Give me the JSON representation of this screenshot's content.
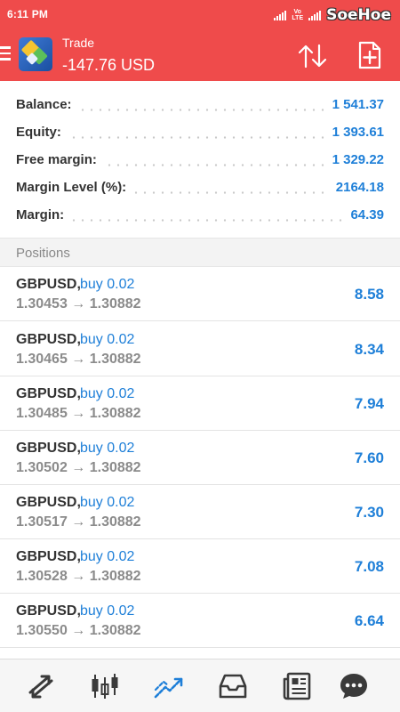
{
  "status_bar": {
    "time": "6:11 PM",
    "network_label": "LTE",
    "watermark": "SoeHoe"
  },
  "header": {
    "title": "Trade",
    "profit": "-147.76 USD",
    "icons": [
      "menu-icon",
      "metatrader-logo",
      "sort-icon",
      "new-order-icon"
    ]
  },
  "summary": {
    "rows": [
      {
        "label": "Balance:",
        "value": "1 541.37"
      },
      {
        "label": "Equity:",
        "value": "1 393.61"
      },
      {
        "label": "Free margin:",
        "value": "1 329.22"
      },
      {
        "label": "Margin Level (%):",
        "value": "2164.18"
      },
      {
        "label": "Margin:",
        "value": "64.39"
      }
    ]
  },
  "positions": {
    "title": "Positions",
    "rows": [
      {
        "symbol": "GBPUSD,",
        "type": "buy 0.02",
        "prices": "1.30453 → 1.30882",
        "profit": "8.58"
      },
      {
        "symbol": "GBPUSD,",
        "type": "buy 0.02",
        "prices": "1.30465 → 1.30882",
        "profit": "8.34"
      },
      {
        "symbol": "GBPUSD,",
        "type": "buy 0.02",
        "prices": "1.30485 → 1.30882",
        "profit": "7.94"
      },
      {
        "symbol": "GBPUSD,",
        "type": "buy 0.02",
        "prices": "1.30502 → 1.30882",
        "profit": "7.60"
      },
      {
        "symbol": "GBPUSD,",
        "type": "buy 0.02",
        "prices": "1.30517 → 1.30882",
        "profit": "7.30"
      },
      {
        "symbol": "GBPUSD,",
        "type": "buy 0.02",
        "prices": "1.30528 → 1.30882",
        "profit": "7.08"
      },
      {
        "symbol": "GBPUSD,",
        "type": "buy 0.02",
        "prices": "1.30550 → 1.30882",
        "profit": "6.64"
      }
    ]
  },
  "bottom_nav": {
    "items": [
      "quotes-icon",
      "chart-icon",
      "trade-icon",
      "history-icon",
      "news-icon",
      "chat-icon"
    ],
    "active": "trade-icon"
  },
  "colors": {
    "header_bg": "#ef4b4b",
    "accent_blue": "#1e7fd8",
    "label_text": "#333333",
    "muted_text": "#8b8b8b",
    "nav_icon": "#3a3a3a"
  }
}
